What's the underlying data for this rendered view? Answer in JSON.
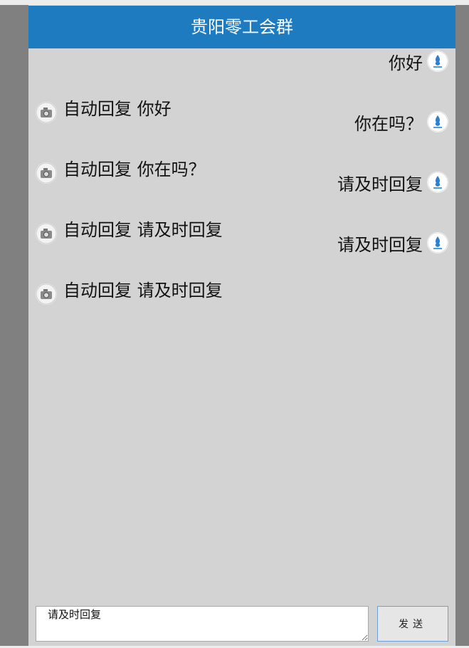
{
  "header": {
    "title": "贵阳零工会群"
  },
  "messages": [
    {
      "sent": "你好",
      "reply": "自动回复 你好"
    },
    {
      "sent": "你在吗？",
      "reply": "自动回复 你在吗？"
    },
    {
      "sent": "请及时回复",
      "reply": "自动回复 请及时回复"
    },
    {
      "sent": "请及时回复",
      "reply": "自动回复 请及时回复"
    }
  ],
  "composer": {
    "value": "请及时回复",
    "send_label": "发送"
  },
  "icons": {
    "user_avatar": "user-avatar-icon",
    "bot_avatar": "camera-avatar-icon"
  },
  "colors": {
    "header_bg": "#1e7bbf",
    "chat_bg": "#d3d3d3",
    "page_bg": "#808080"
  }
}
